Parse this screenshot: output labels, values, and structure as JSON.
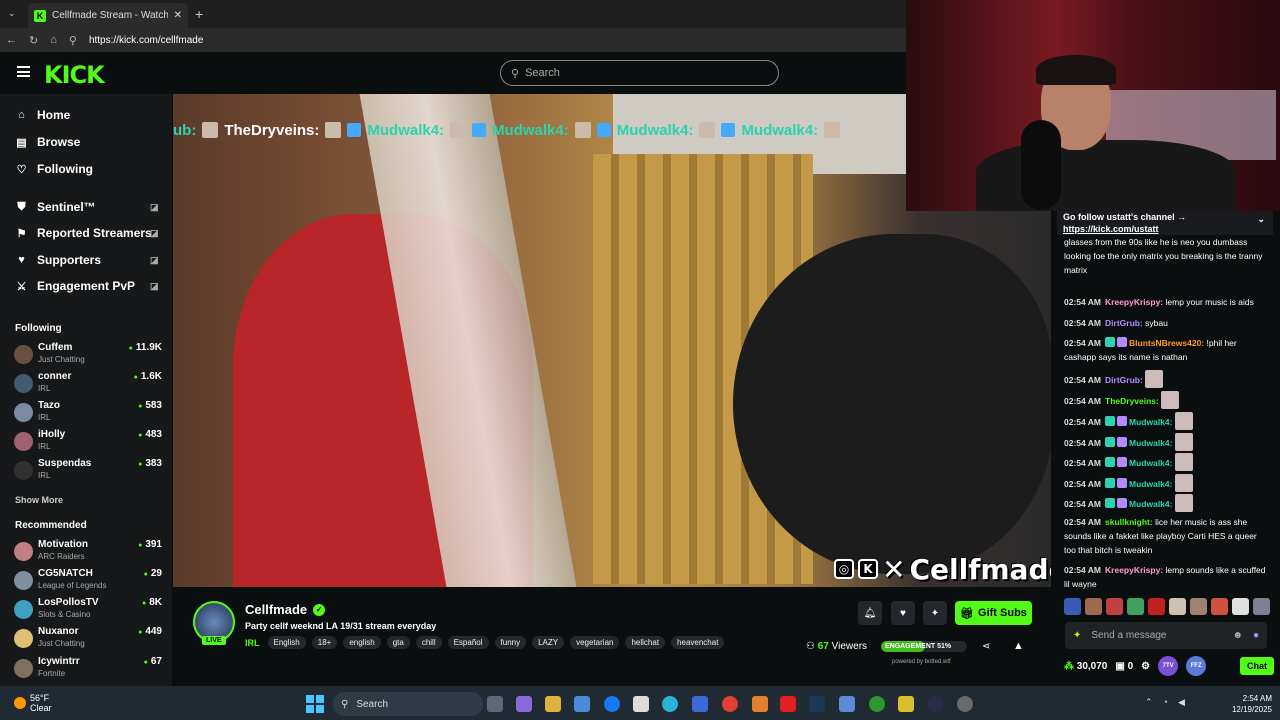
{
  "browser": {
    "tab_title": "Cellfmade Stream - Watch Li",
    "url": "https://kick.com/cellfmade"
  },
  "header": {
    "logo": "KICK",
    "search_placeholder": "Search"
  },
  "sidebar": {
    "nav": [
      {
        "label": "Home",
        "icon": "home-icon"
      },
      {
        "label": "Browse",
        "icon": "browse-icon"
      },
      {
        "label": "Following",
        "icon": "heart-icon"
      }
    ],
    "extras": [
      {
        "label": "Sentinel™",
        "icon": "shield-icon"
      },
      {
        "label": "Reported Streamers",
        "icon": "flag-icon"
      },
      {
        "label": "Supporters",
        "icon": "heart-icon"
      },
      {
        "label": "Engagement PvP",
        "icon": "swords-icon"
      }
    ],
    "following_title": "Following",
    "following": [
      {
        "name": "Cuffem",
        "category": "Just Chatting",
        "viewers": "11.9K"
      },
      {
        "name": "conner",
        "category": "IRL",
        "viewers": "1.6K"
      },
      {
        "name": "Tazo",
        "category": "IRL",
        "viewers": "583"
      },
      {
        "name": "iHolly",
        "category": "IRL",
        "viewers": "483"
      },
      {
        "name": "Suspendas",
        "category": "IRL",
        "viewers": "383"
      }
    ],
    "show_more": "Show More",
    "recommended_title": "Recommended",
    "recommended": [
      {
        "name": "Motivation",
        "category": "ARC Raiders",
        "viewers": "391"
      },
      {
        "name": "CG5NATCH",
        "category": "League of Legends",
        "viewers": "29"
      },
      {
        "name": "LosPollosTV",
        "category": "Slots & Casino",
        "viewers": "8K"
      },
      {
        "name": "Nuxanor",
        "category": "Just Chatting",
        "viewers": "449"
      },
      {
        "name": "Icywintrr",
        "category": "Fortnite",
        "viewers": "67"
      }
    ]
  },
  "video": {
    "overlay_chat": {
      "prefix": "ub:",
      "user1": "TheDryveins:",
      "user2": "Mudwalk4:",
      "user3": "Mudwalk4:",
      "user4": "Mudwalk4:",
      "user5": "Mudwalk4:"
    },
    "watermark": "Cellfmade"
  },
  "stream": {
    "channel": "Cellfmade",
    "live_badge": "LIVE",
    "title": "Party cellf weeknd LA 19/31 stream everyday",
    "category": "IRL",
    "tags": [
      "English",
      "18+",
      "english",
      "gta",
      "chill",
      "Español",
      "funny",
      "LAZY",
      "vegetarian",
      "hellchat",
      "heavenchat"
    ],
    "gift_subs": "Gift Subs",
    "viewers_count": "67",
    "viewers_label": "Viewers",
    "engagement_label": "ENGAGEMENT",
    "engagement_value": "51%",
    "engagement_fraction": 0.51,
    "powered": "powered by botted.wtf"
  },
  "chat": {
    "pinned_text": "Go follow ustatt's channel →",
    "pinned_link": "https://kick.com/ustatt",
    "messages": [
      {
        "time": "",
        "user": "",
        "color": "#ffffff",
        "text": "glasses from the 90s like he is neo you dumbass looking foe the only matrix you breaking is the tranny matrix"
      },
      {
        "time": "02:54 AM",
        "user": "KreepyKrispy:",
        "color": "#ff9ad8",
        "text": "lemp your music is aids"
      },
      {
        "time": "02:54 AM",
        "user": "DirtGrub:",
        "color": "#b28cff",
        "text": "sybau"
      },
      {
        "time": "02:54 AM",
        "user": "BluntsNBrews420:",
        "color": "#ff9a2a",
        "text": "!phil her cashapp says its name is nathan"
      },
      {
        "time": "02:54 AM",
        "user": "DirtGrub:",
        "color": "#b28cff",
        "text": ""
      },
      {
        "time": "02:54 AM",
        "user": "TheDryveins:",
        "color": "#53fc18",
        "text": ""
      },
      {
        "time": "02:54 AM",
        "user": "Mudwalk4:",
        "color": "#2ad4b0",
        "text": ""
      },
      {
        "time": "02:54 AM",
        "user": "Mudwalk4:",
        "color": "#2ad4b0",
        "text": ""
      },
      {
        "time": "02:54 AM",
        "user": "Mudwalk4:",
        "color": "#2ad4b0",
        "text": ""
      },
      {
        "time": "02:54 AM",
        "user": "Mudwalk4:",
        "color": "#2ad4b0",
        "text": ""
      },
      {
        "time": "02:54 AM",
        "user": "Mudwalk4:",
        "color": "#2ad4b0",
        "text": ""
      },
      {
        "time": "02:54 AM",
        "user": "skullknight:",
        "color": "#53fc18",
        "text": "lice her music is ass she sounds like a fakket like playboy Carti HES a queer too that bitch is tweakin"
      },
      {
        "time": "02:54 AM",
        "user": "KreepyKrispy:",
        "color": "#ff9ad8",
        "text": "lemp sounds like a scuffed lil wayne"
      }
    ],
    "input_placeholder": "Send a message",
    "points": "30,070",
    "count": "0",
    "chat_button": "Chat",
    "pill1": "7TV",
    "pill2": "FFZ"
  },
  "taskbar": {
    "temp": "56°F",
    "weather": "Clear",
    "search": "Search",
    "time": "2:54 AM",
    "date": "12/19/2025"
  }
}
